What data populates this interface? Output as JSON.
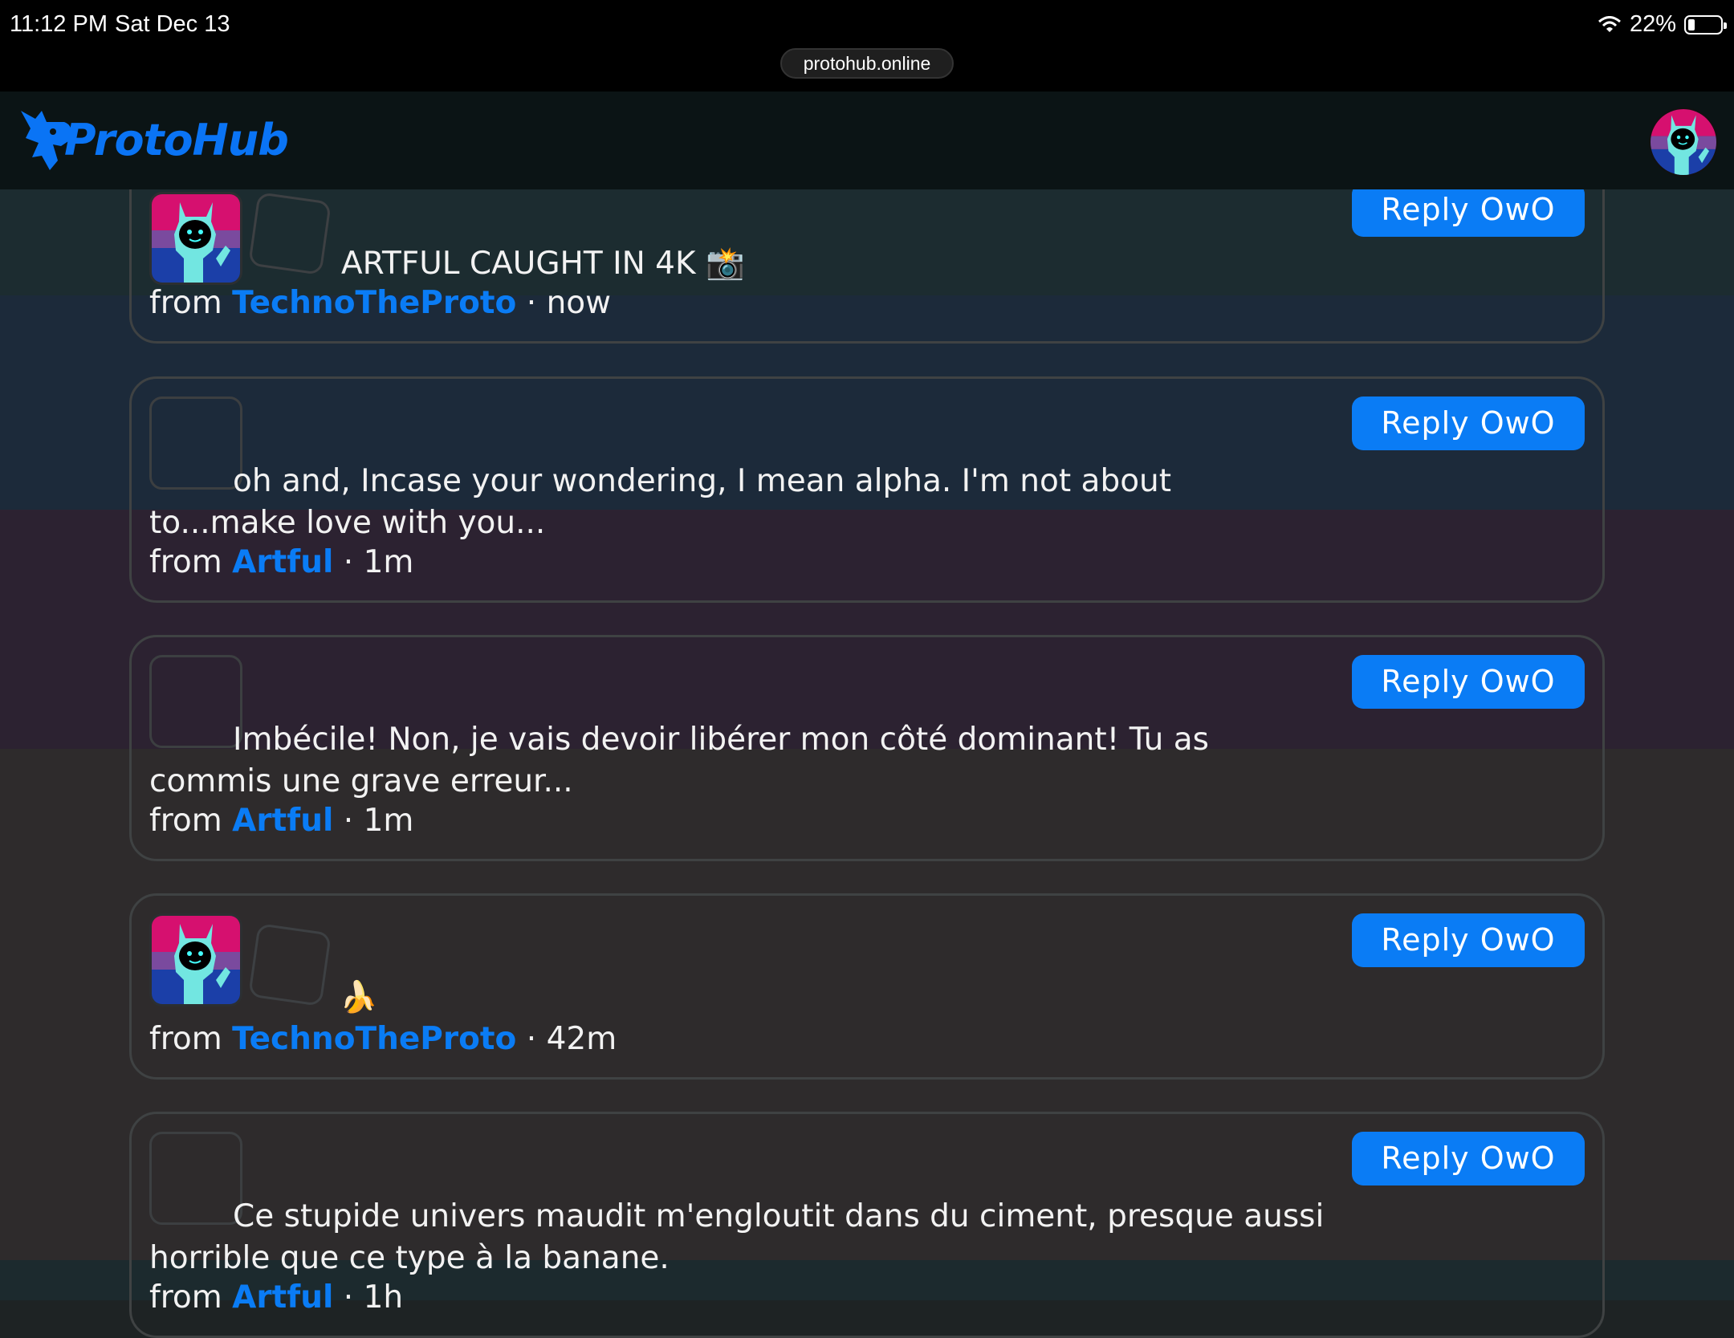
{
  "status_bar": {
    "time": "11:12 PM",
    "date": "Sat Dec 13",
    "battery": "22%",
    "battery_level": 0.22,
    "url": "protohub.online"
  },
  "header": {
    "logo_text": "ProtoHub"
  },
  "reply_label": "Reply OwO",
  "from_label": "from",
  "separator": "·",
  "messages": [
    {
      "text": "ARTFUL CAUGHT IN 4K 📸",
      "user": "TechnoTheProto",
      "time": "now",
      "has_avatar_image": true
    },
    {
      "text": "oh and, Incase your wondering, I mean alpha. I'm not about to...make love with you...",
      "user": "Artful",
      "time": "1m",
      "has_avatar_image": false
    },
    {
      "text": "Imbécile! Non, je vais devoir libérer mon côté dominant! Tu as commis une grave erreur...",
      "user": "Artful",
      "time": "1m",
      "has_avatar_image": false
    },
    {
      "text": "🍌",
      "user": "TechnoTheProto",
      "time": "42m",
      "has_avatar_image": true
    },
    {
      "text": "Ce stupide univers maudit m'engloutit dans du ciment, presque aussi horrible que ce type à la banane.",
      "user": "Artful",
      "time": "1h",
      "has_avatar_image": false
    }
  ],
  "colors": {
    "accent": "#0a7cf5",
    "logo": "#0a74f5",
    "header_bg": "#0b1415",
    "card_border": "#3f4243"
  }
}
